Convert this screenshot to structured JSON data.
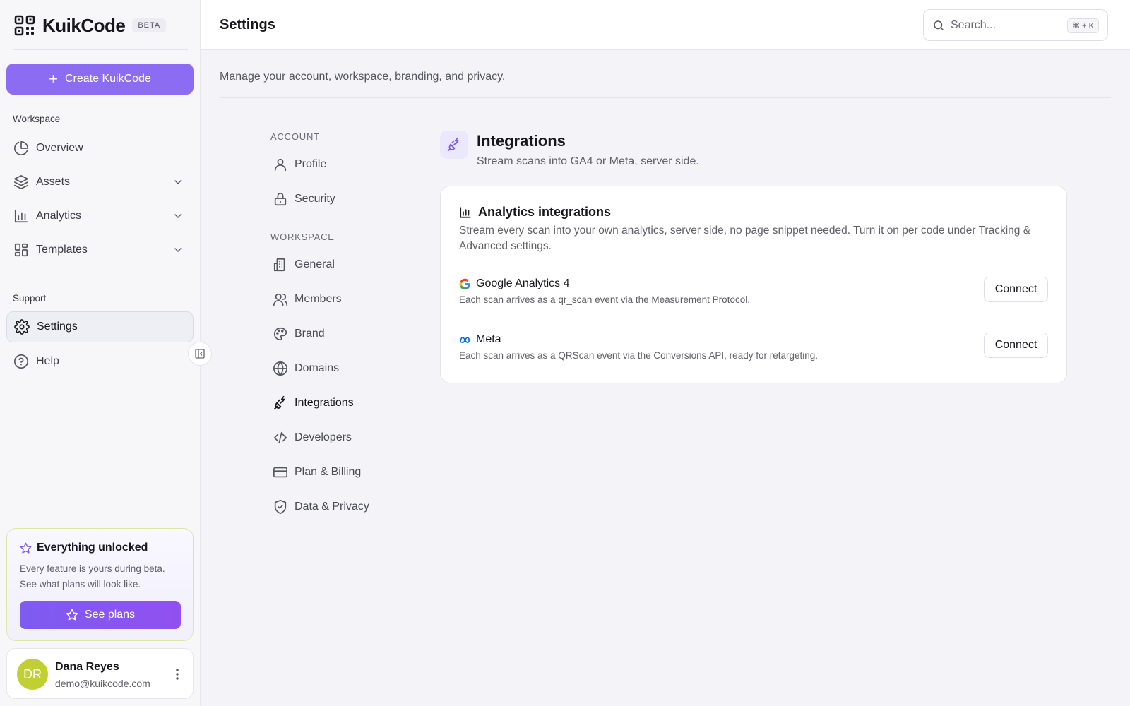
{
  "app": {
    "name": "KuikCode",
    "badge": "BETA"
  },
  "sidebar": {
    "create_label": "Create KuikCode",
    "workspace_label": "Workspace",
    "workspace_items": [
      {
        "label": "Overview",
        "icon": "pie-chart-icon"
      },
      {
        "label": "Assets",
        "icon": "layers-icon"
      },
      {
        "label": "Analytics",
        "icon": "bar-chart-icon"
      },
      {
        "label": "Templates",
        "icon": "layout-grid-icon"
      }
    ],
    "support_label": "Support",
    "support_items": [
      {
        "label": "Settings",
        "icon": "gear-icon",
        "active": true
      },
      {
        "label": "Help",
        "icon": "help-circle-icon"
      }
    ],
    "promo": {
      "title": "Everything unlocked",
      "description": "Every feature is yours during beta. See what plans will look like.",
      "button": "See plans"
    },
    "user": {
      "initials": "DR",
      "name": "Dana Reyes",
      "email": "demo@kuikcode.com"
    }
  },
  "header": {
    "title": "Settings",
    "search_placeholder": "Search...",
    "search_shortcut": "⌘ + K"
  },
  "main": {
    "subtitle": "Manage your account, workspace, branding, and privacy."
  },
  "settings_nav": {
    "account_label": "ACCOUNT",
    "account_items": [
      {
        "label": "Profile",
        "icon": "user-icon"
      },
      {
        "label": "Security",
        "icon": "lock-icon"
      }
    ],
    "workspace_label": "WORKSPACE",
    "workspace_items": [
      {
        "label": "General",
        "icon": "building-icon"
      },
      {
        "label": "Members",
        "icon": "users-icon"
      },
      {
        "label": "Brand",
        "icon": "palette-icon"
      },
      {
        "label": "Domains",
        "icon": "globe-icon"
      },
      {
        "label": "Integrations",
        "icon": "plug-icon",
        "active": true
      },
      {
        "label": "Developers",
        "icon": "code-icon"
      },
      {
        "label": "Plan & Billing",
        "icon": "credit-card-icon"
      },
      {
        "label": "Data & Privacy",
        "icon": "shield-check-icon"
      }
    ]
  },
  "integrations": {
    "title": "Integrations",
    "subtitle": "Stream scans into GA4 or Meta, server side.",
    "card": {
      "title": "Analytics integrations",
      "description": "Stream every scan into your own analytics, server side, no page snippet needed. Turn it on per code under Tracking & Advanced settings.",
      "providers": [
        {
          "name": "Google Analytics 4",
          "icon": "google-icon",
          "description": "Each scan arrives as a qr_scan event via the Measurement Protocol.",
          "button": "Connect"
        },
        {
          "name": "Meta",
          "icon": "meta-icon",
          "description": "Each scan arrives as a QRScan event via the Conversions API, ready for retargeting.",
          "button": "Connect"
        }
      ]
    }
  },
  "colors": {
    "accent": "#8b6cf2",
    "avatar": "#c0cf32",
    "background": "#f4f4f8"
  }
}
